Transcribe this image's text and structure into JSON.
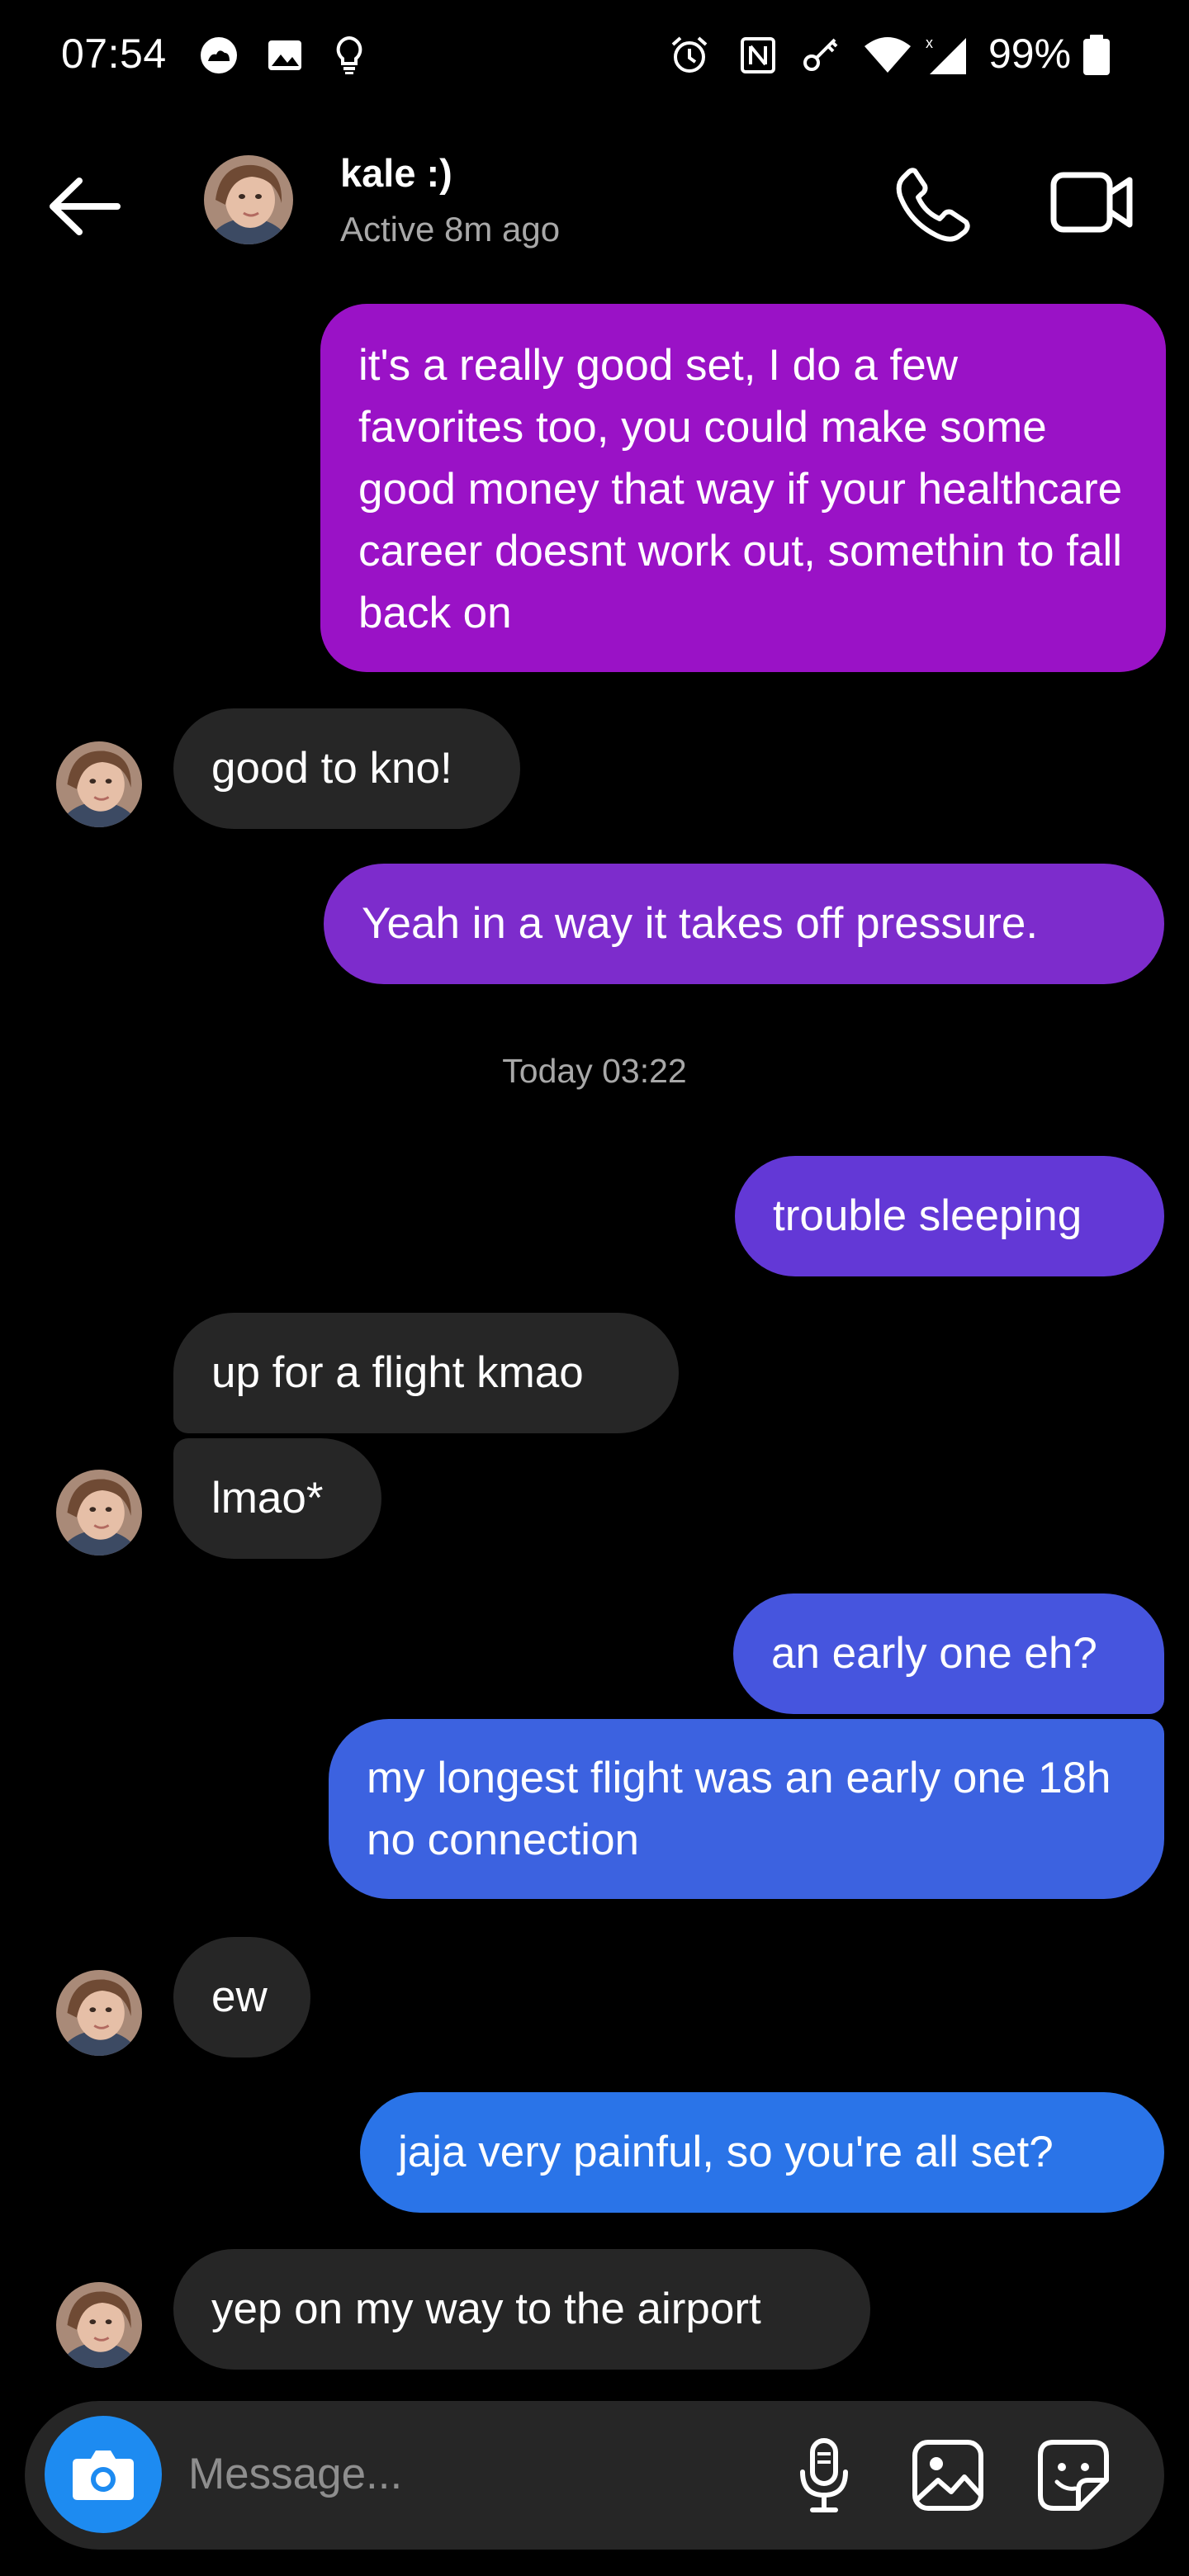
{
  "status_bar": {
    "time": "07:54",
    "battery": "99%",
    "left_icons": [
      "cloud-icon",
      "gallery-icon",
      "lightbulb-icon"
    ],
    "right_icons": [
      "alarm-icon",
      "nfc-icon",
      "vpn-key-icon",
      "wifi-icon",
      "signal-icon",
      "battery-icon"
    ]
  },
  "header": {
    "name": "kale :)",
    "status": "Active 8m ago"
  },
  "messages": [
    {
      "from": "me",
      "text": "it's a really good set, I do a few favorites too, you could make some good money that way if your healthcare career doesnt work out, somethin to fall back on"
    },
    {
      "from": "them",
      "text": "good to kno!"
    },
    {
      "from": "me",
      "text": "Yeah in a way it takes off pressure."
    },
    {
      "timestamp": "Today 03:22"
    },
    {
      "from": "me",
      "text": "trouble sleeping"
    },
    {
      "from": "them",
      "text": "up for a flight kmao"
    },
    {
      "from": "them",
      "text": "lmao*"
    },
    {
      "from": "me",
      "text": "an early one eh?"
    },
    {
      "from": "me",
      "text": "my longest flight was an early one 18h no connection"
    },
    {
      "from": "them",
      "text": "ew"
    },
    {
      "from": "me",
      "text": "jaja very painful, so you're all set?"
    },
    {
      "from": "them",
      "text": "yep on my way to the airport"
    }
  ],
  "composer": {
    "placeholder": "Message..."
  },
  "colors": {
    "background": "#000000",
    "incoming_bubble": "#262626",
    "outgoing_gradient_top": "#a30fc4",
    "outgoing_gradient_bottom": "#2a74e8",
    "camera_button": "#1d8bf1",
    "secondary_text": "#a8a8a8"
  }
}
